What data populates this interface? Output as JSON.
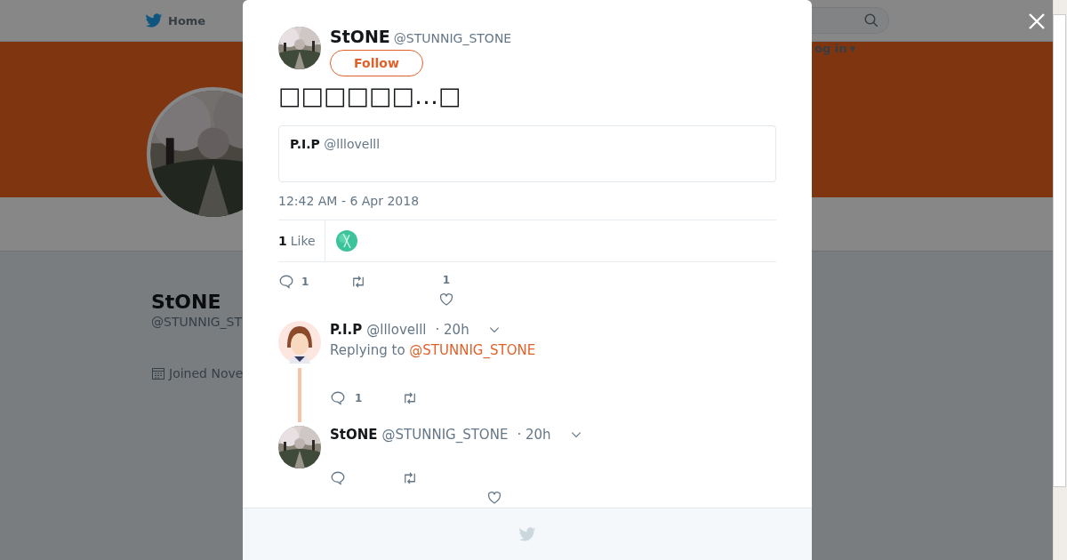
{
  "top_nav": {
    "home": "Home",
    "login": "og in",
    "login_caret": "▾"
  },
  "profile": {
    "name": "StONE",
    "handle": "@STUNNIG_ST",
    "joined": "Joined Nove"
  },
  "tweet": {
    "name": "StONE",
    "handle": "@STUNNIG_STONE",
    "follow": "Follow",
    "text": "□□□□□□…□",
    "quote": {
      "name": "P.I.P",
      "handle": "@lllovelll"
    },
    "timestamp": "12:42 AM - 6 Apr 2018",
    "likes_count": "1",
    "likes_label": "Like",
    "reply_count": "1",
    "like_count": "1"
  },
  "replies": [
    {
      "kind": "cartoon",
      "name": "P.I.P",
      "handle": "@lllovelll",
      "time": "· 20h",
      "replying_label": "Replying to",
      "replying_to": "@STUNNIG_STONE",
      "reply_count": "1"
    },
    {
      "name": "StONE",
      "handle": "@STUNNIG_STONE",
      "time": "· 20h"
    }
  ]
}
